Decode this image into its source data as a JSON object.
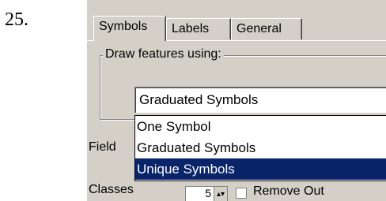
{
  "step_number": "25.",
  "tabs": [
    {
      "label": "Symbols",
      "active": true
    },
    {
      "label": "Labels",
      "active": false
    },
    {
      "label": "General",
      "active": false
    }
  ],
  "group": {
    "label": "Draw features using:"
  },
  "combo": {
    "value": "Graduated Symbols"
  },
  "dropdown": {
    "options": [
      "One Symbol",
      "Graduated Symbols",
      "Unique Symbols"
    ],
    "selected_index": 2
  },
  "fields": {
    "field_label": "Field",
    "classes_label": "Classes",
    "classes_value": "5"
  },
  "checkbox": {
    "label": "Remove Out"
  },
  "colors": {
    "selection": "#0a246a",
    "dialog_bg": "#d4d0c8"
  }
}
